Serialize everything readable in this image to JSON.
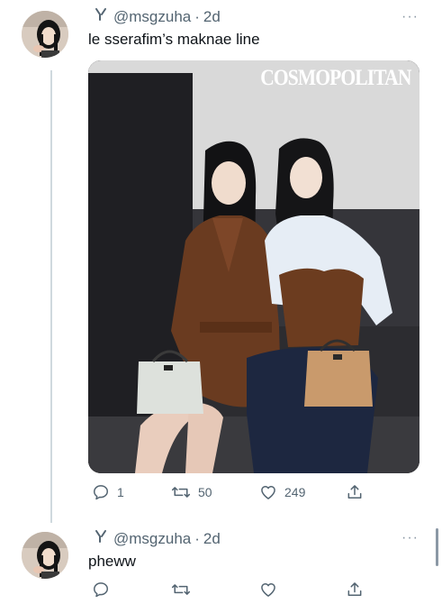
{
  "thread": [
    {
      "handle": "@msgzuha",
      "separator": "·",
      "time": "2d",
      "text": "le sserafim’s maknae line",
      "more_glyph": "···",
      "has_photo": true,
      "photo": {
        "watermark": "COSMOPOLITAN"
      },
      "actions": {
        "reply_count": "1",
        "retweet_count": "50",
        "like_count": "249"
      }
    },
    {
      "handle": "@msgzuha",
      "separator": "·",
      "time": "2d",
      "text": "pheww",
      "more_glyph": "···",
      "has_photo": false,
      "actions": {
        "reply_count": "",
        "retweet_count": "",
        "like_count": ""
      }
    }
  ],
  "icons": {
    "badge": "badge-icon",
    "reply": "reply-icon",
    "retweet": "retweet-icon",
    "like": "like-icon",
    "share": "share-icon",
    "more": "more-icon"
  },
  "colors": {
    "text": "#0f1419",
    "secondary": "#536471",
    "thread_line": "#cfd9de"
  }
}
